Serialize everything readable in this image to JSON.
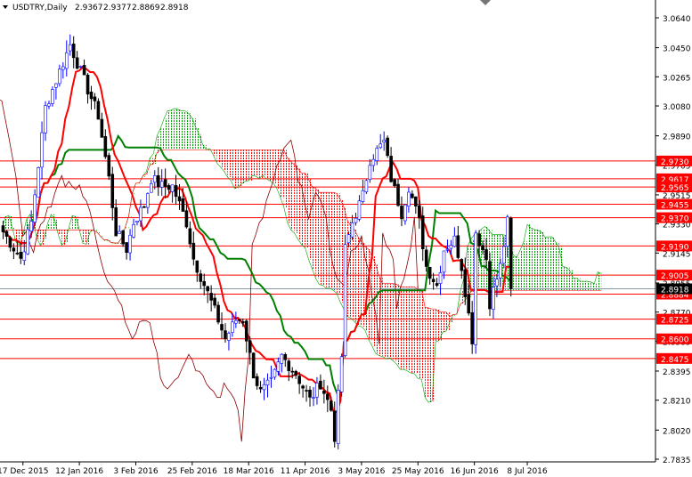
{
  "chart_data": {
    "type": "candlestick",
    "title": "USDTRY,Daily",
    "ohlc_last": [
      "2.9367",
      "2.9377",
      "2.8869",
      "2.8918"
    ],
    "current_price": "2.8918",
    "ylim": [
      2.7835,
      3.064
    ],
    "y_ticks": [
      "3.0640",
      "3.0450",
      "3.0265",
      "3.0080",
      "2.9890",
      "2.9705",
      "2.9515",
      "2.9330",
      "2.9145",
      "2.8955",
      "2.8770",
      "2.8585",
      "2.8395",
      "2.8210",
      "2.8020",
      "2.7835"
    ],
    "x_ticks": [
      {
        "label": "17 Dec 2015",
        "index": 6
      },
      {
        "label": "12 Jan 2016",
        "index": 22
      },
      {
        "label": "3 Feb 2016",
        "index": 38
      },
      {
        "label": "25 Feb 2016",
        "index": 54
      },
      {
        "label": "18 Mar 2016",
        "index": 70
      },
      {
        "label": "11 Apr 2016",
        "index": 86
      },
      {
        "label": "3 May 2016",
        "index": 102
      },
      {
        "label": "25 May 2016",
        "index": 118
      },
      {
        "label": "16 Jun 2016",
        "index": 134
      },
      {
        "label": "8 Jul 2016",
        "index": 149
      }
    ],
    "levels": [
      "2.9730",
      "2.9617",
      "2.9565",
      "2.9455",
      "2.9370",
      "2.9190",
      "2.9005",
      "2.8884",
      "2.8725",
      "2.8600",
      "2.8475"
    ],
    "price_path": [
      [
        0,
        2.928
      ],
      [
        5,
        2.911
      ],
      [
        8,
        2.934
      ],
      [
        12,
        3.007
      ],
      [
        16,
        3.03
      ],
      [
        19,
        3.047
      ],
      [
        23,
        3.024
      ],
      [
        27,
        3.002
      ],
      [
        30,
        2.962
      ],
      [
        32,
        2.928
      ],
      [
        35,
        2.917
      ],
      [
        37,
        2.934
      ],
      [
        40,
        2.945
      ],
      [
        42,
        2.962
      ],
      [
        45,
        2.957
      ],
      [
        48,
        2.957
      ],
      [
        52,
        2.934
      ],
      [
        54,
        2.911
      ],
      [
        58,
        2.889
      ],
      [
        61,
        2.872
      ],
      [
        63,
        2.86
      ],
      [
        66,
        2.872
      ],
      [
        68,
        2.872
      ],
      [
        71,
        2.838
      ],
      [
        73,
        2.826
      ],
      [
        76,
        2.832
      ],
      [
        79,
        2.849
      ],
      [
        83,
        2.838
      ],
      [
        87,
        2.821
      ],
      [
        90,
        2.832
      ],
      [
        93,
        2.815
      ],
      [
        94,
        2.798
      ],
      [
        96,
        2.849
      ],
      [
        97,
        2.917
      ],
      [
        99,
        2.934
      ],
      [
        102,
        2.951
      ],
      [
        104,
        2.974
      ],
      [
        108,
        2.985
      ],
      [
        110,
        2.962
      ],
      [
        113,
        2.94
      ],
      [
        115,
        2.957
      ],
      [
        118,
        2.934
      ],
      [
        120,
        2.906
      ],
      [
        123,
        2.894
      ],
      [
        125,
        2.917
      ],
      [
        128,
        2.923
      ],
      [
        130,
        2.906
      ],
      [
        133,
        2.86
      ],
      [
        134,
        2.928
      ],
      [
        137,
        2.911
      ],
      [
        138,
        2.883
      ],
      [
        141,
        2.906
      ],
      [
        143,
        2.934
      ],
      [
        144,
        2.892
      ]
    ],
    "colors": {
      "bull": "#0000ff",
      "bear": "#000000",
      "tenkan": "#ff0000",
      "kijun": "#008000",
      "chikou": "#8b0000",
      "level": "#ff0000",
      "cloud_up": "#00a000",
      "cloud_down": "#ff0000"
    }
  }
}
